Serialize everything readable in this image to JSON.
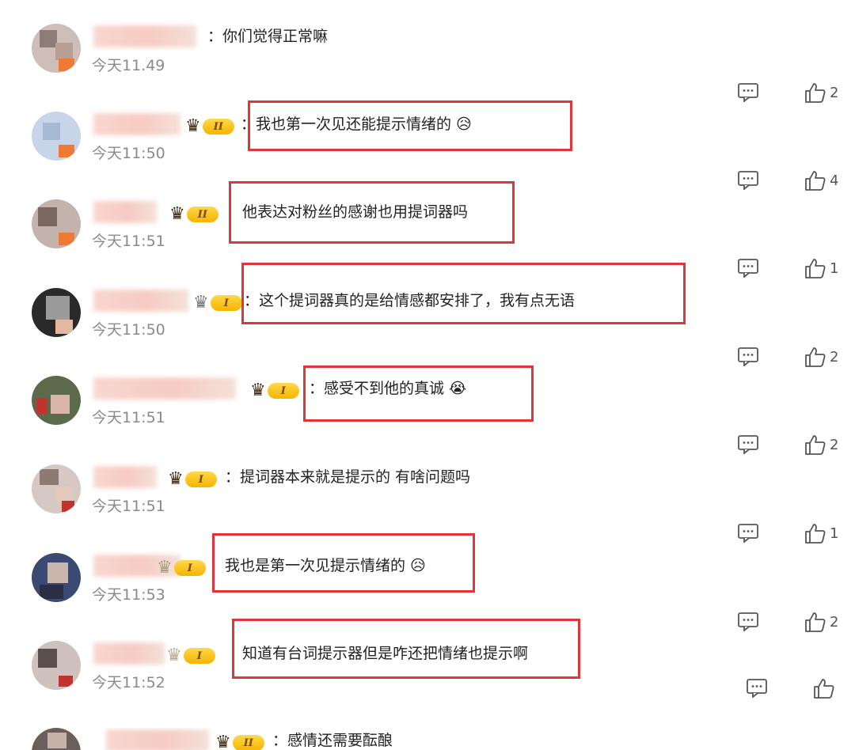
{
  "comments": [
    {
      "text": "：你们觉得正常嘛",
      "time": "今天11.49",
      "likes": "2",
      "badge": "",
      "highlighted": false
    },
    {
      "text": "：我也第一次见还能提示情绪的 😥",
      "time": "今天11:50",
      "likes": "4",
      "badge": "II",
      "highlighted": true
    },
    {
      "text": "他表达对粉丝的感谢也用提词器吗",
      "time": "今天11:51",
      "likes": "1",
      "badge": "II",
      "highlighted": true
    },
    {
      "text": "：这个提词器真的是给情感都安排了，我有点无语",
      "time": "今天11:50",
      "likes": "2",
      "badge": "I",
      "highlighted": true
    },
    {
      "text": "：感受不到他的真诚 😭",
      "time": "今天11:51",
      "likes": "2",
      "badge": "I",
      "highlighted": true
    },
    {
      "text": "：提词器本来就是提示的 有啥问题吗",
      "time": "今天11:51",
      "likes": "1",
      "badge": "I",
      "highlighted": false
    },
    {
      "text": "我也是第一次见提示情绪的 😥",
      "time": "今天11:53",
      "likes": "2",
      "badge": "I",
      "highlighted": true
    },
    {
      "text": "知道有台词提示器但是咋还把情绪也提示啊",
      "time": "今天11:52",
      "likes": "",
      "badge": "I",
      "highlighted": true
    },
    {
      "text": "：感情还需要酝酿",
      "time": "",
      "likes": "",
      "badge": "II",
      "highlighted": false
    }
  ],
  "icons": {
    "reply": "comment-icon",
    "like": "thumbs-up-icon",
    "crown": "crown-icon"
  },
  "colors": {
    "highlight": "#e0353b",
    "badge": "#f5b400",
    "time": "#8a8a8a"
  }
}
